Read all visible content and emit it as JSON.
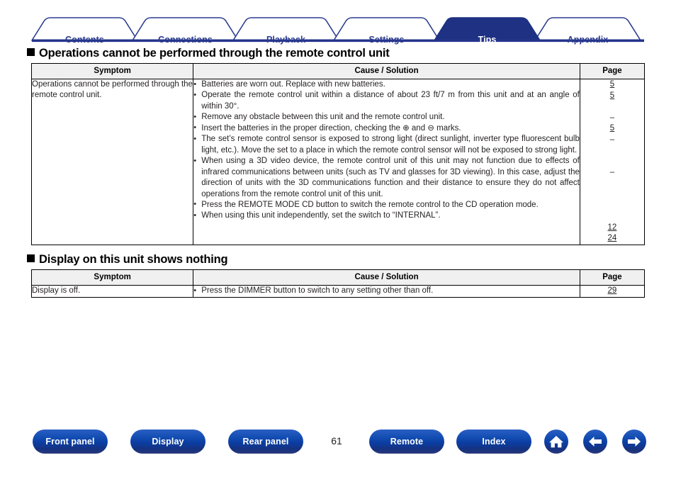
{
  "tabs": [
    {
      "label": "Contents",
      "active": false
    },
    {
      "label": "Connections",
      "active": false
    },
    {
      "label": "Playback",
      "active": false
    },
    {
      "label": "Settings",
      "active": false
    },
    {
      "label": "Tips",
      "active": true
    },
    {
      "label": "Appendix",
      "active": false
    }
  ],
  "sections": [
    {
      "heading": "Operations cannot be performed through the remote control unit",
      "columns": [
        "Symptom",
        "Cause / Solution",
        "Page"
      ],
      "row": {
        "symptom": "Operations cannot be performed through the remote control unit.",
        "bullets": [
          "Batteries are worn out. Replace with new batteries.",
          "Operate the remote control unit within a distance of about 23 ft/7 m from this unit and at an angle of within 30°.",
          "Remove any obstacle between this unit and the remote control unit.",
          "Insert the batteries in the proper direction, checking the ⊕ and ⊖ marks.",
          "The set’s remote control sensor is exposed to strong light (direct sunlight, inverter type fluorescent bulb light, etc.). Move the set to a place in which the remote control sensor will not be exposed to strong light.",
          "When using a 3D video device, the remote control unit of this unit may not function due to effects of infrared communications between units (such as TV and glasses for 3D viewing). In this case, adjust the direction of units with the 3D communications function and their distance to ensure they do not affect operations from the remote control unit of this unit.",
          "Press the REMOTE MODE CD button to switch the remote control to the CD operation mode.",
          "When using this unit independently, set the switch to “INTERNAL”."
        ],
        "pages": [
          {
            "text": "5",
            "link": true,
            "row": 0
          },
          {
            "text": "5",
            "link": true,
            "row": 1
          },
          {
            "text": "",
            "link": false,
            "row": 2
          },
          {
            "text": "–",
            "link": false,
            "row": 3
          },
          {
            "text": "5",
            "link": true,
            "row": 4
          },
          {
            "text": "–",
            "link": false,
            "row": 5
          },
          {
            "text": "",
            "link": false,
            "row": 6
          },
          {
            "text": "",
            "link": false,
            "row": 7
          },
          {
            "text": "–",
            "link": false,
            "row": 8
          },
          {
            "text": "",
            "link": false,
            "row": 9
          },
          {
            "text": "",
            "link": false,
            "row": 10
          },
          {
            "text": "",
            "link": false,
            "row": 11
          },
          {
            "text": "",
            "link": false,
            "row": 12
          },
          {
            "text": "12",
            "link": true,
            "row": 13
          },
          {
            "text": "24",
            "link": true,
            "row": 14
          }
        ]
      }
    },
    {
      "heading": "Display on this unit shows nothing",
      "columns": [
        "Symptom",
        "Cause / Solution",
        "Page"
      ],
      "row": {
        "symptom": "Display is off.",
        "bullets": [
          "Press the DIMMER button to switch to any setting other than off."
        ],
        "pages": [
          {
            "text": "29",
            "link": true,
            "row": 0
          }
        ]
      }
    }
  ],
  "footer": {
    "pills": [
      {
        "label": "Front panel"
      },
      {
        "label": "Display"
      },
      {
        "label": "Rear panel"
      },
      {
        "label": "Remote"
      },
      {
        "label": "Index"
      }
    ],
    "page_number": "61",
    "icons": [
      {
        "name": "home-icon"
      },
      {
        "name": "arrow-left-icon"
      },
      {
        "name": "arrow-right-icon"
      }
    ]
  },
  "colors": {
    "tab_blue": "#2b3c8f",
    "tab_active_fill": "#1e3182",
    "baseline": "#26348c",
    "button_blue": "#1550b5"
  }
}
